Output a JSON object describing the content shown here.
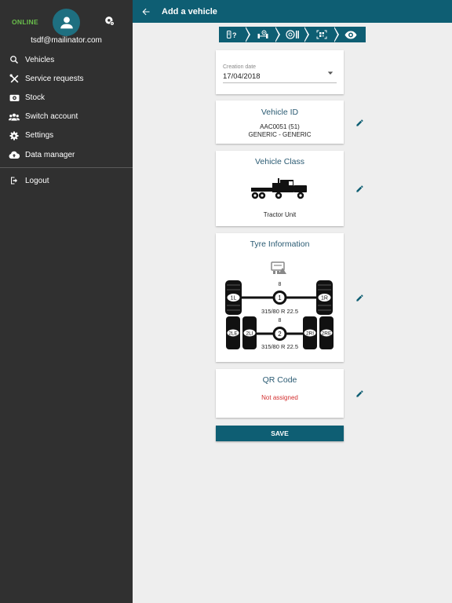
{
  "sidebar": {
    "status": "ONLINE",
    "email": "tsdf@mailinator.com",
    "items": [
      {
        "label": "Vehicles",
        "icon": "search-icon"
      },
      {
        "label": "Service requests",
        "icon": "tools-icon"
      },
      {
        "label": "Stock",
        "icon": "stock-icon"
      },
      {
        "label": "Switch account",
        "icon": "users-icon"
      },
      {
        "label": "Settings",
        "icon": "gear-icon"
      },
      {
        "label": "Data manager",
        "icon": "cloud-upload-icon"
      }
    ],
    "logout": {
      "label": "Logout",
      "icon": "logout-icon"
    }
  },
  "topbar": {
    "title": "Add a vehicle"
  },
  "steps": [
    "vehicle-question-icon",
    "axle-config-icon",
    "tyre-icon",
    "qr-scan-icon",
    "eye-icon"
  ],
  "creation": {
    "label": "Creation date",
    "value": "17/04/2018"
  },
  "vehicle_id": {
    "title": "Vehicle ID",
    "line1": "AAC0051 (51)",
    "line2": "GENERIC - GENERIC"
  },
  "vehicle_class": {
    "title": "Vehicle Class",
    "label": "Tractor Unit"
  },
  "tyre_info": {
    "title": "Tyre Information",
    "axle1": {
      "count": "8",
      "number": "1",
      "size": "315/80 R 22.5",
      "left": "1L",
      "right": "1R"
    },
    "axle2": {
      "count": "8",
      "number": "2",
      "size": "315/80 R 22.5",
      "le": "2LE",
      "li": "2LI",
      "ri": "2RI",
      "re": "2RE"
    }
  },
  "qr": {
    "title": "QR Code",
    "status": "Not assigned"
  },
  "save_label": "SAVE",
  "colors": {
    "primary": "#0e5e73",
    "online": "#6abf4b",
    "error": "#d32f2f",
    "title": "#2b5b73"
  }
}
